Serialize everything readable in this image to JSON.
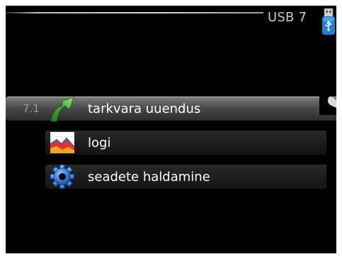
{
  "header": {
    "title": "USB 7",
    "usb_icon": "usb-stick-icon"
  },
  "menu": {
    "items": [
      {
        "number": "7.1",
        "label": "tarkvara uuendus",
        "icon": "update-arrow-icon",
        "selected": true
      },
      {
        "number": "",
        "label": "logi",
        "icon": "log-chart-icon",
        "selected": false
      },
      {
        "number": "",
        "label": "seadete haldamine",
        "icon": "settings-gear-icon",
        "selected": false
      }
    ]
  },
  "colors": {
    "background": "#000000",
    "text": "#ffffff",
    "selected_bar": "#5a5a5a",
    "usb_blue": "#1f7fd4"
  }
}
